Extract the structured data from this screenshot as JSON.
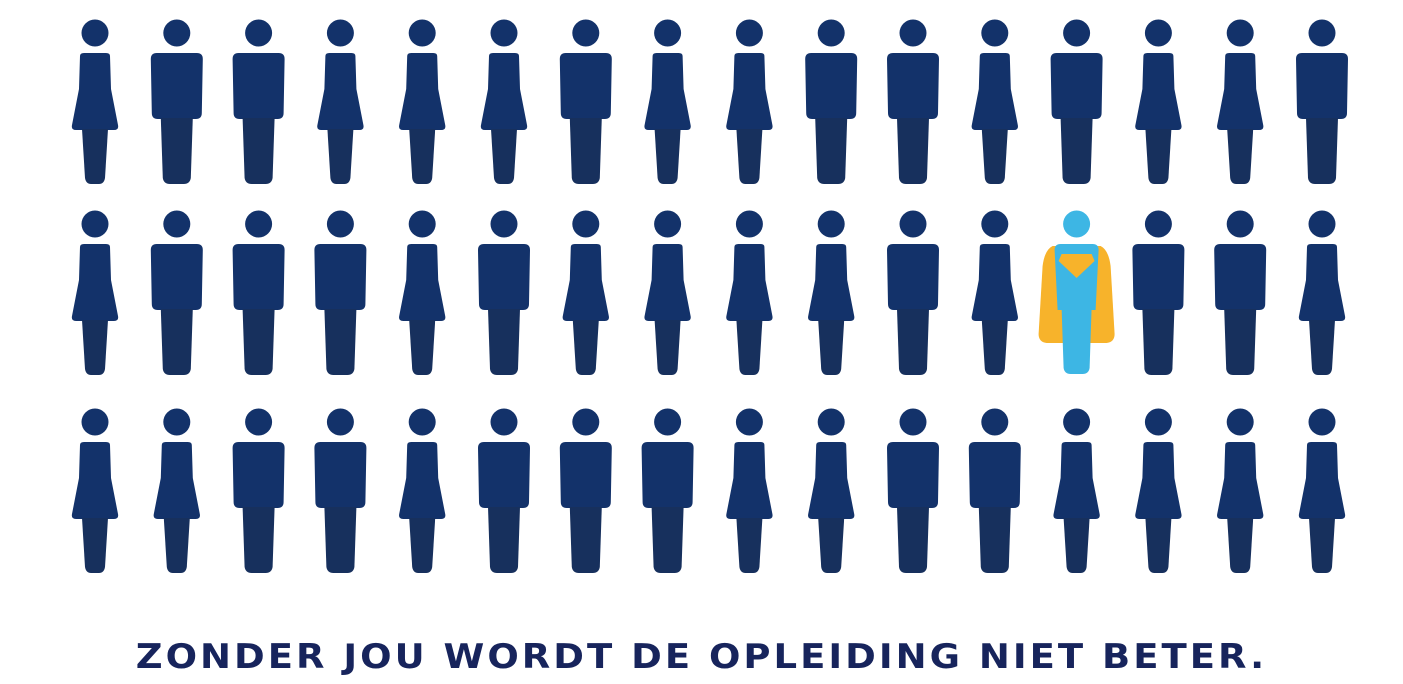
{
  "tagline": "ZONDER JOU WORDT DE OPLEIDING NIET BETER.",
  "colors": {
    "figure": "#13326a",
    "figure_legs": "#17305d",
    "hero_body": "#3db6e4",
    "hero_cape": "#f7b32b",
    "tagline": "#17245c"
  },
  "figures": {
    "rows": [
      [
        "f",
        "m",
        "m",
        "f",
        "f",
        "f",
        "m",
        "f",
        "f",
        "m",
        "m",
        "f",
        "m",
        "f",
        "f",
        "m"
      ],
      [
        "f",
        "m",
        "m",
        "m",
        "f",
        "m",
        "f",
        "f",
        "f",
        "f",
        "m",
        "f",
        "hero",
        "m",
        "m",
        "f"
      ],
      [
        "f",
        "f",
        "m",
        "m",
        "f",
        "m",
        "m",
        "m",
        "f",
        "f",
        "m",
        "m",
        "f",
        "f",
        "f",
        "f"
      ]
    ],
    "highlight_icon": "superhero-icon",
    "person_icon": "person-icon"
  }
}
